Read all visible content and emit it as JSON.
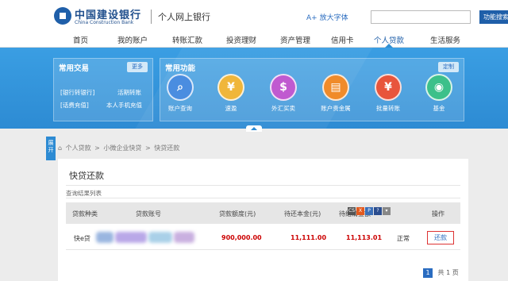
{
  "header": {
    "bank_name": "中国建设银行",
    "bank_name_en": "China Construction Bank",
    "site_name": "个人网上银行",
    "font_toggle": "放大字体",
    "search_placeholder": "",
    "search_button": "功能搜索"
  },
  "nav": {
    "items": [
      "首页",
      "我的账户",
      "转账汇款",
      "投资理财",
      "资产管理",
      "信用卡",
      "个人贷款",
      "生活服务"
    ],
    "active": "个人贷款"
  },
  "banner": {
    "common_trade": {
      "title": "常用交易",
      "button": "更多",
      "links": [
        "[银行转银行]",
        "活期转账",
        "[话费充值]",
        "本人手机充值"
      ]
    },
    "common_func": {
      "title": "常用功能",
      "button": "定制",
      "items": [
        {
          "label": "账户查询",
          "icon": "account-query-icon",
          "glyph": "🔍",
          "color": "#4a8de0"
        },
        {
          "label": "速盈",
          "icon": "su-ying-icon",
          "glyph": "¥",
          "color": "#f0b63a"
        },
        {
          "label": "外汇买卖",
          "icon": "forex-icon",
          "glyph": "$",
          "color": "#c05ad0"
        },
        {
          "label": "账户贵金属",
          "icon": "gold-icon",
          "glyph": "▤",
          "color": "#f08b2a"
        },
        {
          "label": "批量转账",
          "icon": "batch-transfer-icon",
          "glyph": "¥",
          "color": "#e8553c"
        },
        {
          "label": "基金",
          "icon": "fund-icon",
          "glyph": "◉",
          "color": "#3cc08a"
        }
      ]
    }
  },
  "side_tab": "展开",
  "breadcrumb": [
    "个人贷款",
    ">",
    "小微企业快贷",
    ">",
    "快贷还款"
  ],
  "content": {
    "title": "快贷还款",
    "result_label": "查询结果列表",
    "columns": [
      "贷款种类",
      "贷款账号",
      "贷款额度(元)",
      "待还本金(元)",
      "待结清金额",
      "状态",
      "操作"
    ],
    "row": {
      "type": "快e贷",
      "account": "",
      "limit": "900,000.00",
      "principal": "11,111.00",
      "settle": "11,113.01",
      "status": "正常",
      "action": "还款"
    },
    "toolbar_icons": [
      {
        "name": "csv-icon",
        "glyph": "CS",
        "color": "#555"
      },
      {
        "name": "excel-icon",
        "glyph": "X",
        "color": "#e35a1f"
      },
      {
        "name": "print-icon",
        "glyph": "P",
        "color": "#3a6fb8"
      },
      {
        "name": "help-icon",
        "glyph": "?",
        "color": "#2a4d8f"
      },
      {
        "name": "dropdown-icon",
        "glyph": "▾",
        "color": "#888"
      }
    ]
  },
  "pager": {
    "current": "1",
    "total_text": "共 1 页"
  }
}
